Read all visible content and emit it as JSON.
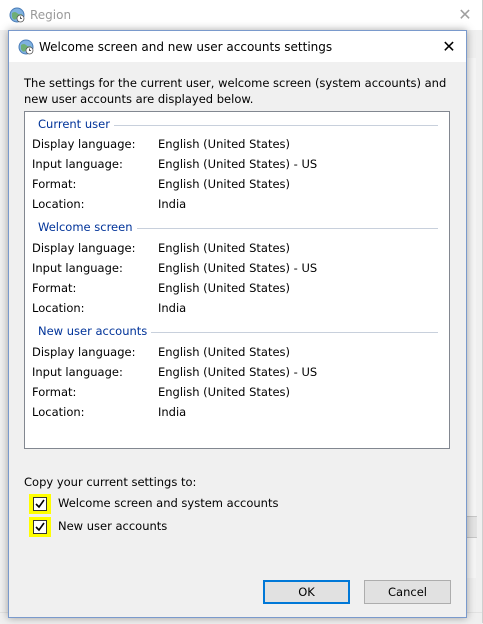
{
  "outer_window": {
    "title": "Region"
  },
  "dialog": {
    "title": "Welcome screen and new user accounts settings",
    "intro": "The settings for the current user, welcome screen (system accounts) and new user accounts are displayed below."
  },
  "sections": [
    {
      "title": "Current user",
      "rows": [
        {
          "label": "Display language:",
          "value": "English (United States)"
        },
        {
          "label": "Input language:",
          "value": "English (United States) - US"
        },
        {
          "label": "Format:",
          "value": "English (United States)"
        },
        {
          "label": "Location:",
          "value": "India"
        }
      ]
    },
    {
      "title": "Welcome screen",
      "rows": [
        {
          "label": "Display language:",
          "value": "English (United States)"
        },
        {
          "label": "Input language:",
          "value": "English (United States) - US"
        },
        {
          "label": "Format:",
          "value": "English (United States)"
        },
        {
          "label": "Location:",
          "value": "India"
        }
      ]
    },
    {
      "title": "New user accounts",
      "rows": [
        {
          "label": "Display language:",
          "value": "English (United States)"
        },
        {
          "label": "Input language:",
          "value": "English (United States) - US"
        },
        {
          "label": "Format:",
          "value": "English (United States)"
        },
        {
          "label": "Location:",
          "value": "India"
        }
      ]
    }
  ],
  "copy": {
    "label": "Copy your current settings to:",
    "options": [
      {
        "label": "Welcome screen and system accounts",
        "checked": true
      },
      {
        "label": "New user accounts",
        "checked": true
      }
    ]
  },
  "buttons": {
    "ok": "OK",
    "cancel": "Cancel"
  },
  "icons": {
    "app": "globe-clock-icon",
    "close": "close-icon",
    "check": "checkmark-icon"
  },
  "colors": {
    "section_title": "#003399",
    "highlight": "#ffff00",
    "ok_border": "#0078d7"
  }
}
